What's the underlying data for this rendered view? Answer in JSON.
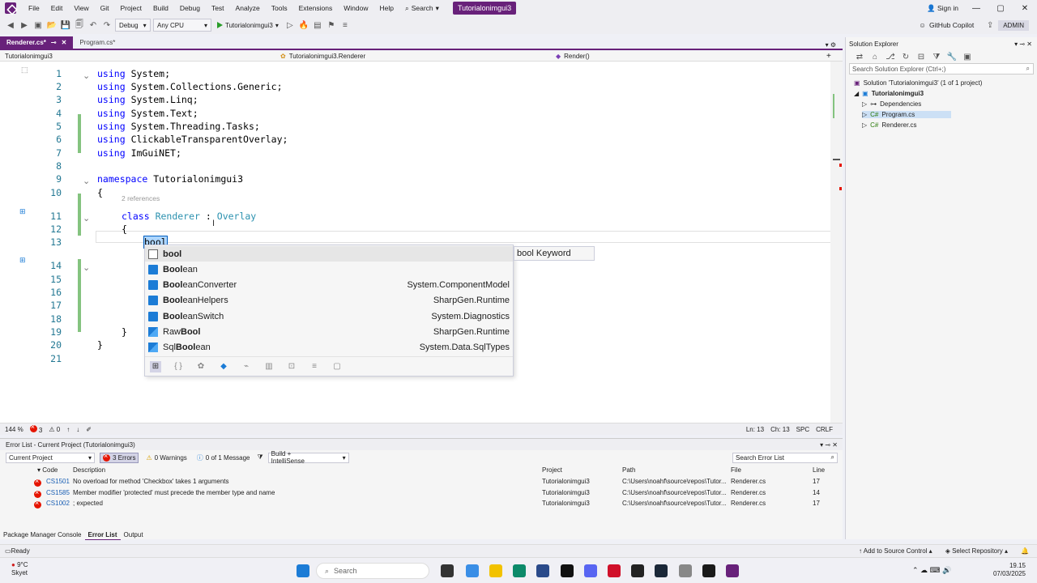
{
  "menubar": {
    "items": [
      "File",
      "Edit",
      "View",
      "Git",
      "Project",
      "Build",
      "Debug",
      "Test",
      "Analyze",
      "Tools",
      "Extensions",
      "Window",
      "Help"
    ],
    "search_label": "Search",
    "active_project": "Tutorialonimgui3",
    "sign_in": "Sign in"
  },
  "toolbar": {
    "config": "Debug",
    "platform": "Any CPU",
    "run_target": "Tutorialonimgui3",
    "copilot": "GitHub Copilot",
    "admin": "ADMIN"
  },
  "tabs": [
    {
      "label": "Renderer.cs*",
      "active": true
    },
    {
      "label": "Program.cs*",
      "active": false
    }
  ],
  "navbar": {
    "project": "Tutorialonimgui3",
    "class": "Tutorialonimgui3.Renderer",
    "member": "Render()"
  },
  "editor": {
    "lines": [
      {
        "n": "1",
        "code": [
          [
            "kw",
            "using"
          ],
          [
            "",
            "System;"
          ]
        ]
      },
      {
        "n": "2",
        "code": [
          [
            "kw",
            "using"
          ],
          [
            "",
            "System.Collections.Generic;"
          ]
        ]
      },
      {
        "n": "3",
        "code": [
          [
            "kw",
            "using"
          ],
          [
            "",
            "System.Linq;"
          ]
        ]
      },
      {
        "n": "4",
        "code": [
          [
            "kw",
            "using"
          ],
          [
            "",
            "System.Text;"
          ]
        ]
      },
      {
        "n": "5",
        "code": [
          [
            "kw",
            "using"
          ],
          [
            "",
            "System.Threading.Tasks;"
          ]
        ]
      },
      {
        "n": "6",
        "code": [
          [
            "kw",
            "using"
          ],
          [
            "",
            "ClickableTransparentOverlay;"
          ]
        ]
      },
      {
        "n": "7",
        "code": [
          [
            "kw",
            "using"
          ],
          [
            "",
            "ImGuiNET;"
          ]
        ]
      },
      {
        "n": "8",
        "code": []
      },
      {
        "n": "9",
        "code": [
          [
            "kw",
            "namespace"
          ],
          [
            "",
            "Tutorialonimgui3"
          ]
        ]
      },
      {
        "n": "10",
        "code": [
          [
            "",
            "{"
          ]
        ]
      },
      {
        "n": "11",
        "code": [
          [
            "kw",
            "class"
          ],
          [
            "ty",
            "Renderer"
          ],
          [
            "",
            ":"
          ],
          [
            "ty",
            "Overlay"
          ]
        ]
      },
      {
        "n": "12",
        "code": [
          [
            "",
            "{"
          ]
        ]
      },
      {
        "n": "13",
        "code": [
          [
            "typed",
            "bool"
          ]
        ]
      },
      {
        "n": "14",
        "code": []
      },
      {
        "n": "15",
        "code": []
      },
      {
        "n": "16",
        "code": []
      },
      {
        "n": "17",
        "code": []
      },
      {
        "n": "18",
        "code": []
      },
      {
        "n": "19",
        "code": [
          [
            "",
            "}"
          ]
        ]
      },
      {
        "n": "20",
        "code": [
          [
            "",
            "}"
          ]
        ]
      },
      {
        "n": "21",
        "code": []
      }
    ],
    "references": "2 references"
  },
  "autocomplete": {
    "items": [
      {
        "prefix": "",
        "bold": "bool",
        "suffix": "",
        "ns": "",
        "kind": "keyword"
      },
      {
        "prefix": "",
        "bold": "Bool",
        "suffix": "ean",
        "ns": "",
        "kind": "class"
      },
      {
        "prefix": "",
        "bold": "Bool",
        "suffix": "eanConverter",
        "ns": "System.ComponentModel",
        "kind": "class"
      },
      {
        "prefix": "",
        "bold": "Bool",
        "suffix": "eanHelpers",
        "ns": "SharpGen.Runtime",
        "kind": "class"
      },
      {
        "prefix": "",
        "bold": "Bool",
        "suffix": "eanSwitch",
        "ns": "System.Diagnostics",
        "kind": "class"
      },
      {
        "prefix": "Raw",
        "bold": "Bool",
        "suffix": "",
        "ns": "SharpGen.Runtime",
        "kind": "struct"
      },
      {
        "prefix": "Sql",
        "bold": "Bool",
        "suffix": "ean",
        "ns": "System.Data.SqlTypes",
        "kind": "struct"
      }
    ],
    "tooltip": "bool Keyword"
  },
  "editor_status": {
    "zoom": "144 %",
    "errors": "3",
    "warnings": "0",
    "position": "Ln: 13",
    "column": "Ch: 13",
    "spc": "SPC",
    "crlf": "CRLF"
  },
  "solution_explorer": {
    "title": "Solution Explorer",
    "search_placeholder": "Search Solution Explorer (Ctrl+;)",
    "solution": "Solution 'Tutorialonimgui3' (1 of 1 project)",
    "project": "Tutorialonimgui3",
    "items": [
      "Dependencies",
      "Program.cs",
      "Renderer.cs"
    ]
  },
  "error_list": {
    "title": "Error List - Current Project (Tutorialonimgui3)",
    "scope": "Current Project",
    "errors_pill": "3 Errors",
    "warnings_pill": "0 Warnings",
    "messages_pill": "0 of 1 Message",
    "build_filter": "Build + IntelliSense",
    "search": "Search Error List",
    "columns": [
      "Code",
      "Description",
      "Project",
      "Path",
      "File",
      "Line"
    ],
    "rows": [
      {
        "code": "CS1501",
        "desc": "No overload for method 'Checkbox' takes 1 arguments",
        "project": "Tutorialonimgui3",
        "path": "C:\\Users\\noahf\\source\\repos\\Tutor...",
        "file": "Renderer.cs",
        "line": "17"
      },
      {
        "code": "CS1585",
        "desc": "Member modifier 'protected' must precede the member type and name",
        "project": "Tutorialonimgui3",
        "path": "C:\\Users\\noahf\\source\\repos\\Tutor...",
        "file": "Renderer.cs",
        "line": "14"
      },
      {
        "code": "CS1002",
        "desc": "; expected",
        "project": "Tutorialonimgui3",
        "path": "C:\\Users\\noahf\\source\\repos\\Tutor...",
        "file": "Renderer.cs",
        "line": "17"
      }
    ]
  },
  "bottom_tabs": [
    "Package Manager Console",
    "Error List",
    "Output"
  ],
  "statusbar": {
    "ready": "Ready",
    "source_control": "Add to Source Control",
    "repo": "Select Repository"
  },
  "taskbar": {
    "temp": "9°C",
    "weather": "Skyet",
    "search": "Search",
    "time": "19.15",
    "date": "07/03/2025"
  }
}
